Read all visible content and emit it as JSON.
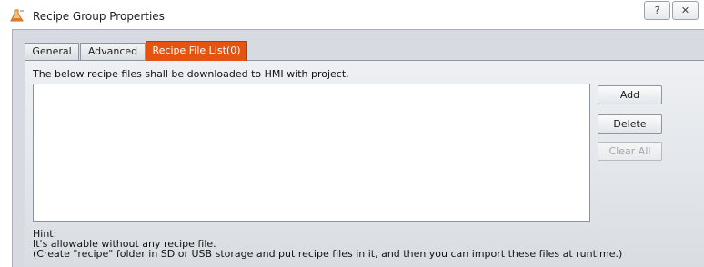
{
  "window": {
    "title": "Recipe Group Properties",
    "help_glyph": "?",
    "close_glyph": "✕"
  },
  "tabs": [
    {
      "label": "General"
    },
    {
      "label": "Advanced"
    },
    {
      "label": "Recipe File List(0)",
      "active": true
    }
  ],
  "panel": {
    "description": "The below recipe files shall be downloaded to HMI with project."
  },
  "buttons": {
    "add": "Add",
    "delete": "Delete",
    "clear_all": "Clear All"
  },
  "hint": {
    "line1": "Hint:",
    "line2": " It's allowable without any recipe file.",
    "line3": "(Create \"recipe\" folder in SD or USB storage and put recipe files in it, and then you can import these files at runtime.)"
  },
  "colors": {
    "active_tab": "#e45410",
    "frame": "#d7dbe1"
  }
}
